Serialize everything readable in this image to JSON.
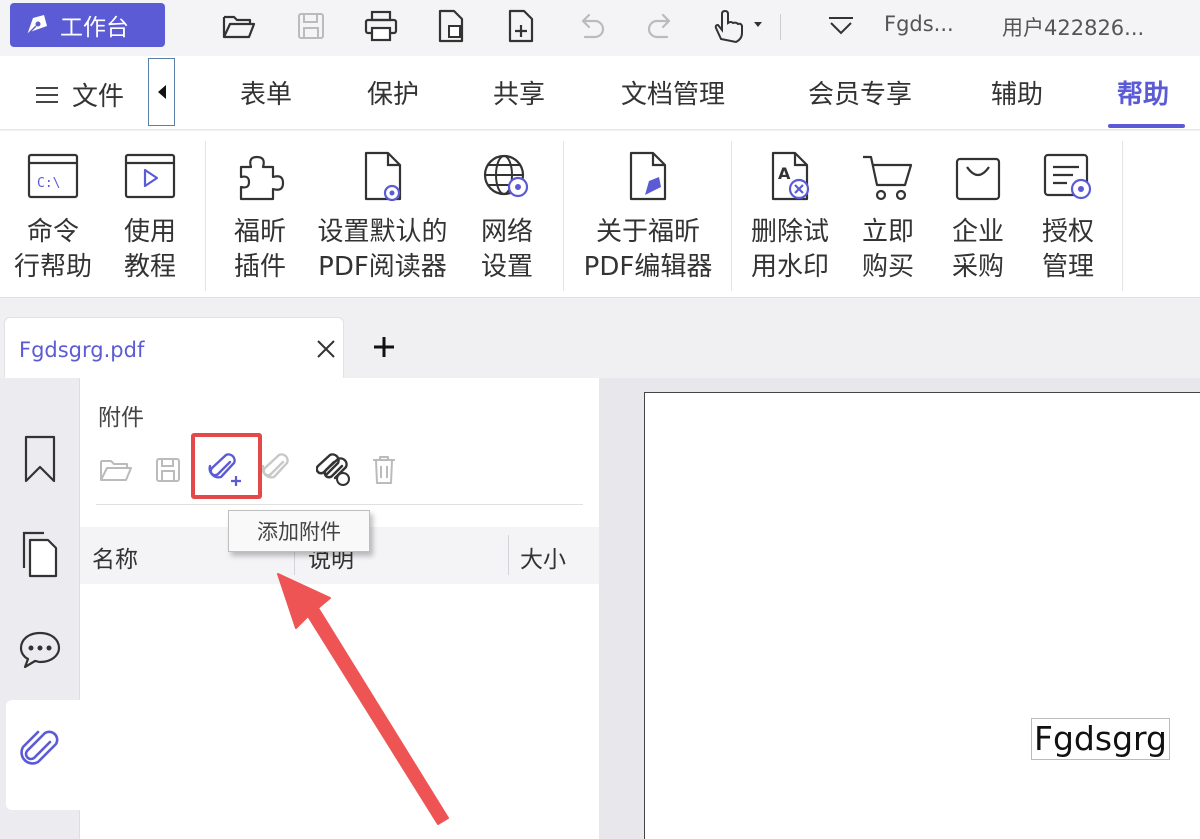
{
  "quickbar": {
    "workbench_label": "工作台",
    "filename_short": "Fgds...",
    "user": "用户422826...",
    "icons": [
      "open-folder-icon",
      "save-icon",
      "print-icon",
      "new-doc-icon",
      "new-file-icon",
      "undo-icon",
      "redo-icon",
      "hand-tool-icon",
      "dropdown-icon"
    ]
  },
  "ribbon": {
    "file_label": "文件",
    "tabs": [
      "表单",
      "保护",
      "共享",
      "文档管理",
      "会员专享",
      "辅助",
      "帮助"
    ],
    "active_tab": "帮助",
    "commands": [
      {
        "label": "命令\n行帮助",
        "icon": "command-line-icon"
      },
      {
        "label": "使用\n教程",
        "icon": "tutorial-icon"
      },
      {
        "label": "福昕\n插件",
        "icon": "plugin-icon"
      },
      {
        "label": "设置默认的\nPDF阅读器",
        "icon": "default-reader-icon"
      },
      {
        "label": "网络\n设置",
        "icon": "network-settings-icon"
      },
      {
        "label": "关于福昕\nPDF编辑器",
        "icon": "about-icon"
      },
      {
        "label": "删除试\n用水印",
        "icon": "remove-watermark-icon"
      },
      {
        "label": "立即\n购买",
        "icon": "cart-icon"
      },
      {
        "label": "企业\n采购",
        "icon": "bag-icon"
      },
      {
        "label": "授权\n管理",
        "icon": "license-icon"
      }
    ]
  },
  "doc_tab": {
    "title": "Fgdsgrg.pdf",
    "close": "×",
    "new_tab": "+"
  },
  "attachments_panel": {
    "title": "附件",
    "tooltip": "添加附件",
    "columns": [
      "名称",
      "说明",
      "大小"
    ],
    "toolbar_icons": [
      "open-attachment-icon",
      "save-attachment-icon",
      "add-attachment-icon",
      "edit-attachment-icon",
      "multi-attachment-icon",
      "delete-attachment-icon"
    ]
  },
  "document": {
    "text": "Fgdsgrg"
  },
  "colors": {
    "accent": "#5b5bd6",
    "highlight": "#e54848"
  }
}
